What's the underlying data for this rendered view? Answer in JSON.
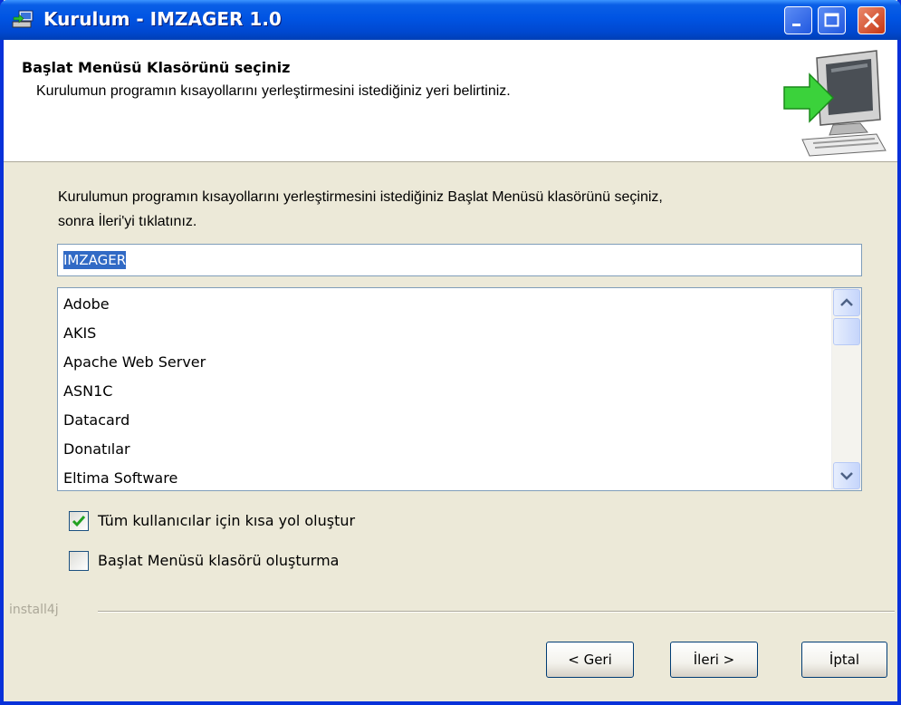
{
  "window": {
    "title": "Kurulum - IMZAGER 1.0"
  },
  "header": {
    "title": "Başlat Menüsü Klasörünü seçiniz",
    "subtitle": "Kurulumun programın kısayollarını yerleştirmesini istediğiniz yeri belirtiniz."
  },
  "main": {
    "instruction_line1": "Kurulumun programın kısayollarını yerleştirmesini istediğiniz Başlat Menüsü klasörünü seçiniz,",
    "instruction_line2": "sonra İleri'yi tıklatınız.",
    "folder_name": "IMZAGER",
    "folders": [
      "Adobe",
      "AKIS",
      "Apache Web Server",
      "ASN1C",
      "Datacard",
      "Donatılar",
      "Eltima Software"
    ],
    "option_all_users": {
      "label": "Tüm kullanıcılar için kısa yol oluştur",
      "checked": true
    },
    "option_no_folder": {
      "label": "Başlat Menüsü klasörü oluşturma",
      "checked": false
    }
  },
  "footer": {
    "brand": "install4j",
    "back_label": "< Geri",
    "next_label": "İleri >",
    "cancel_label": "İptal"
  },
  "colors": {
    "titlebar": "#0054e3",
    "selection": "#316ac5",
    "checkmark": "#21a121",
    "close_button": "#c63512"
  }
}
